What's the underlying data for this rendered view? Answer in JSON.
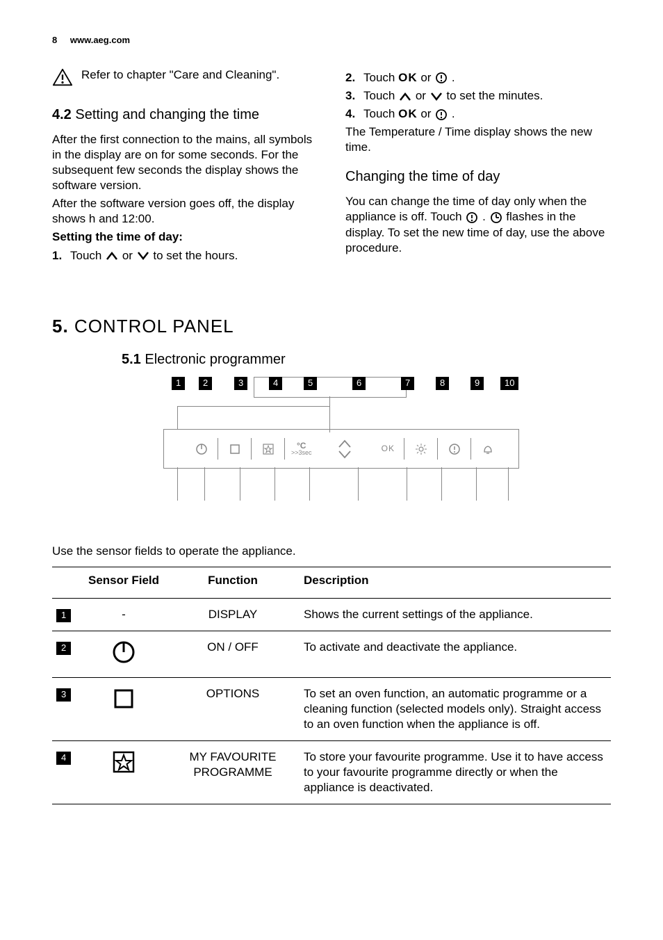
{
  "header": {
    "page": "8",
    "site": "www.aeg.com"
  },
  "colLeft": {
    "warnText": "Refer to chapter \"Care and Cleaning\".",
    "sec42num": "4.2",
    "sec42title": " Setting and changing the time",
    "para1": "After the first connection to the mains, all symbols in the display are on for some seconds. For the subsequent few seconds the display shows the software version.",
    "para2": "After the software version goes off, the display shows h and 12:00.",
    "subhead": "Setting the time of day:",
    "step1n": "1.",
    "step1a": "Touch ",
    "step1b": " or ",
    "step1c": " to set the hours."
  },
  "colRight": {
    "step2n": "2.",
    "step2a": "Touch ",
    "ok": "OK",
    "step2b": " or ",
    "step2c": " .",
    "step3n": "3.",
    "step3a": "Touch ",
    "step3b": " or ",
    "step3c": " to set the minutes.",
    "step4n": "4.",
    "step4a": "Touch ",
    "step4b": " or ",
    "step4c": " .",
    "after": "The Temperature / Time display shows the new time.",
    "h3": "Changing the time of day",
    "p2a": "You can change the time of day only when the appliance is off. Touch ",
    "p2b": " . ",
    "p2c": " flashes in the display. To set the new time of day, use the above procedure."
  },
  "sec5": {
    "num": "5.",
    "title": " CONTROL PANEL",
    "sub_num": "5.1",
    "sub_title": " Electronic programmer",
    "useText": "Use the sensor fields to operate the appliance.",
    "labels": {
      "n1": "1",
      "n2": "2",
      "n3": "3",
      "n4": "4",
      "n5": "5",
      "n6": "6",
      "n7": "7",
      "n8": "8",
      "n9": "9",
      "n10": "10"
    },
    "degC": "°C",
    "degCsub": ">>3sec",
    "okBtn": "OK"
  },
  "table": {
    "head": {
      "c1": "Sensor Field",
      "c2": "Function",
      "c3": "Description"
    },
    "rows": [
      {
        "n": "1",
        "sensor": "-",
        "func": "DISPLAY",
        "desc": "Shows the current settings of the appliance."
      },
      {
        "n": "2",
        "sensor": "power",
        "func": "ON / OFF",
        "desc": "To activate and deactivate the appliance."
      },
      {
        "n": "3",
        "sensor": "square",
        "func": "OPTIONS",
        "desc": "To set an oven function, an automatic programme or a cleaning function (selected models only). Straight access to an oven function when the appliance is off."
      },
      {
        "n": "4",
        "sensor": "star",
        "func": "MY FAVOURITE PROGRAMME",
        "desc": "To store your favourite programme. Use it to have access to your favourite programme directly or when the appliance is deactivated."
      }
    ]
  }
}
